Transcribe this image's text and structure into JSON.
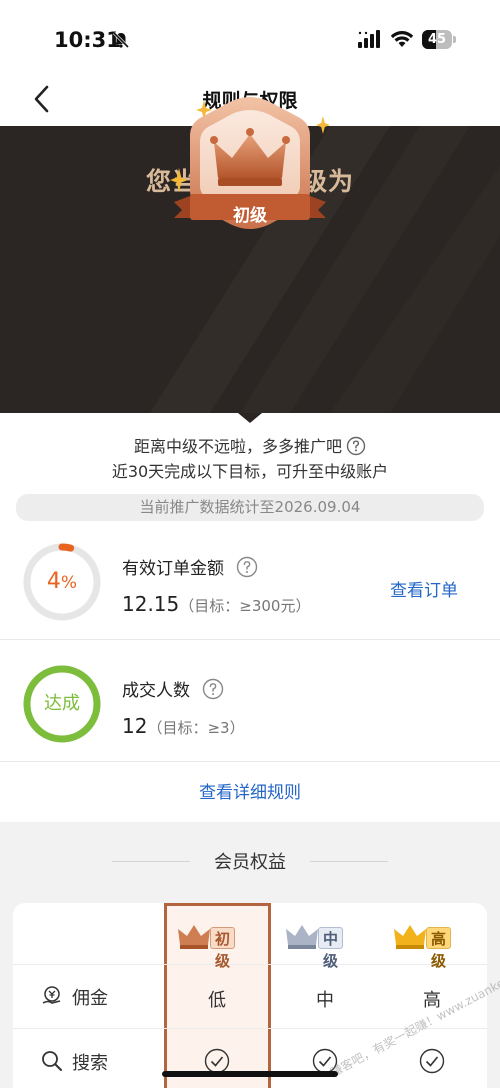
{
  "status_bar": {
    "time": "10:31",
    "battery": "45",
    "battery_level": 0.45
  },
  "nav": {
    "title": "规则与权限"
  },
  "hero": {
    "title": "您当前账户等级为",
    "level": "初级"
  },
  "goal": {
    "line1": "距离中级不远啦，多多推广吧",
    "line2": "近30天完成以下目标，可升至中级账户",
    "stat_date": "当前推广数据统计至2026.09.04"
  },
  "metrics": [
    {
      "percent_number": "4",
      "percent_sign": "%",
      "progress": 0.04,
      "label": "有效订单金额",
      "value": "12.15",
      "target": "（目标：≥300元）",
      "action": "查看订单"
    },
    {
      "status": "达成",
      "progress": 1.0,
      "label": "成交人数",
      "value": "12",
      "target": "（目标：≥3）"
    }
  ],
  "detail_rules": "查看详细规则",
  "benefits": {
    "heading": "会员权益",
    "tiers": [
      "初级",
      "中级",
      "高级"
    ],
    "rows": [
      {
        "name": "佣金",
        "icon": "commission-icon",
        "values": [
          "低",
          "中",
          "高"
        ]
      },
      {
        "name": "搜索",
        "icon": "search-icon",
        "values": [
          "check",
          "check",
          "check"
        ]
      }
    ]
  },
  "watermark": "赚客吧，有奖一起赚！www.zuanke8.com",
  "colors": {
    "hero_bg": "#2b2623",
    "accent_orange": "#e8631f",
    "done_green": "#7dbd3c",
    "link_blue": "#2567c8",
    "highlight_border": "#b3653f"
  }
}
